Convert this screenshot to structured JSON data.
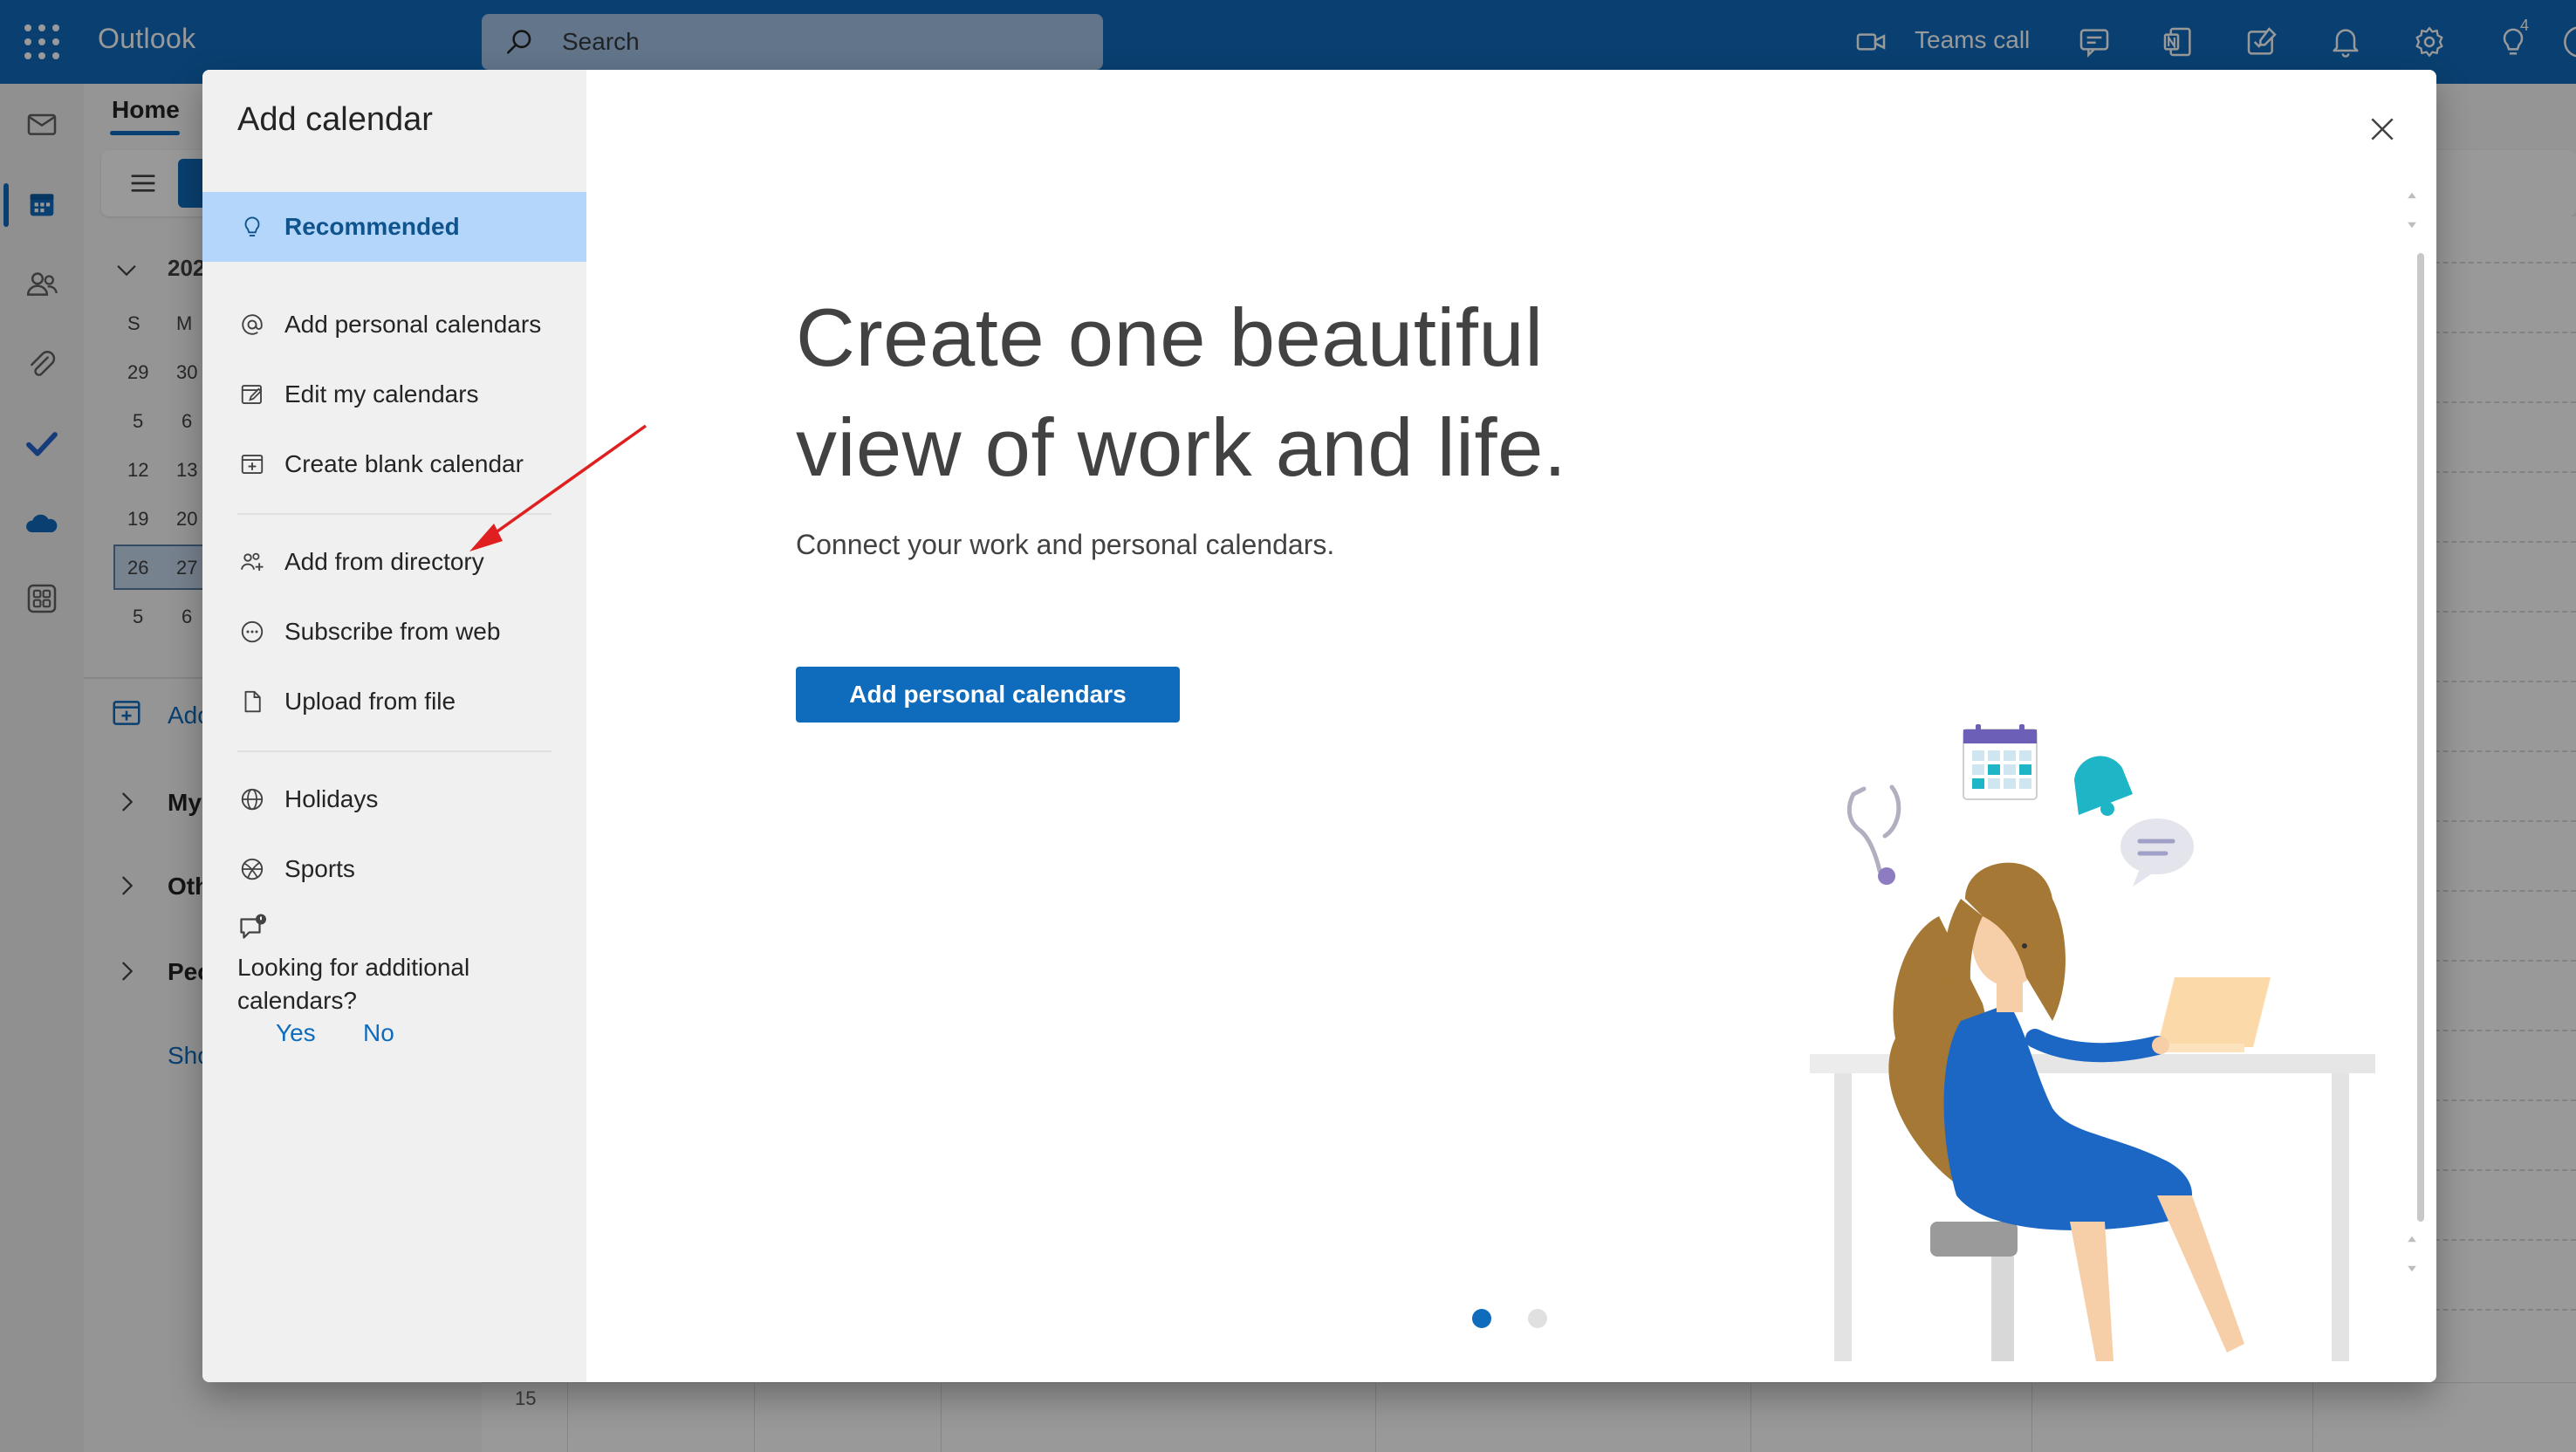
{
  "app": {
    "title": "Outlook",
    "search_placeholder": "Search",
    "teams_call_label": "Teams call",
    "notification_badge": "4",
    "accent": "#0f6cbd"
  },
  "background": {
    "home_tab": "Home",
    "year_label": "202",
    "mini_calendar": {
      "day_headers": [
        "S",
        "M"
      ],
      "rows": [
        [
          "29",
          "30"
        ],
        [
          "5",
          "6"
        ],
        [
          "12",
          "13"
        ],
        [
          "19",
          "20"
        ],
        [
          "26",
          "27"
        ],
        [
          "5",
          "6"
        ]
      ]
    },
    "side_items": [
      "Ado",
      "My",
      "Oth",
      "Peo",
      "Sho"
    ],
    "time_row_label": "15"
  },
  "dialog": {
    "title": "Add calendar",
    "nav": {
      "recommended": "Recommended",
      "add_personal": "Add personal calendars",
      "edit_my": "Edit my calendars",
      "create_blank": "Create blank calendar",
      "add_from_directory": "Add from directory",
      "subscribe_web": "Subscribe from web",
      "upload_file": "Upload from file",
      "holidays": "Holidays",
      "sports": "Sports"
    },
    "feedback": {
      "question": "Looking for additional calendars?",
      "yes": "Yes",
      "no": "No"
    },
    "hero": {
      "line1": "Create one beautiful",
      "line2": "view of work and life.",
      "subtitle": "Connect your work and personal calendars.",
      "button": "Add personal calendars"
    },
    "carousel": {
      "page_count": 2,
      "active_page": 1,
      "active_color": "#0f6cbd",
      "inactive_color": "#e0e0e0"
    }
  },
  "annotation": {
    "arrow_color": "#e02020",
    "arrow_target": "add-from-directory"
  }
}
